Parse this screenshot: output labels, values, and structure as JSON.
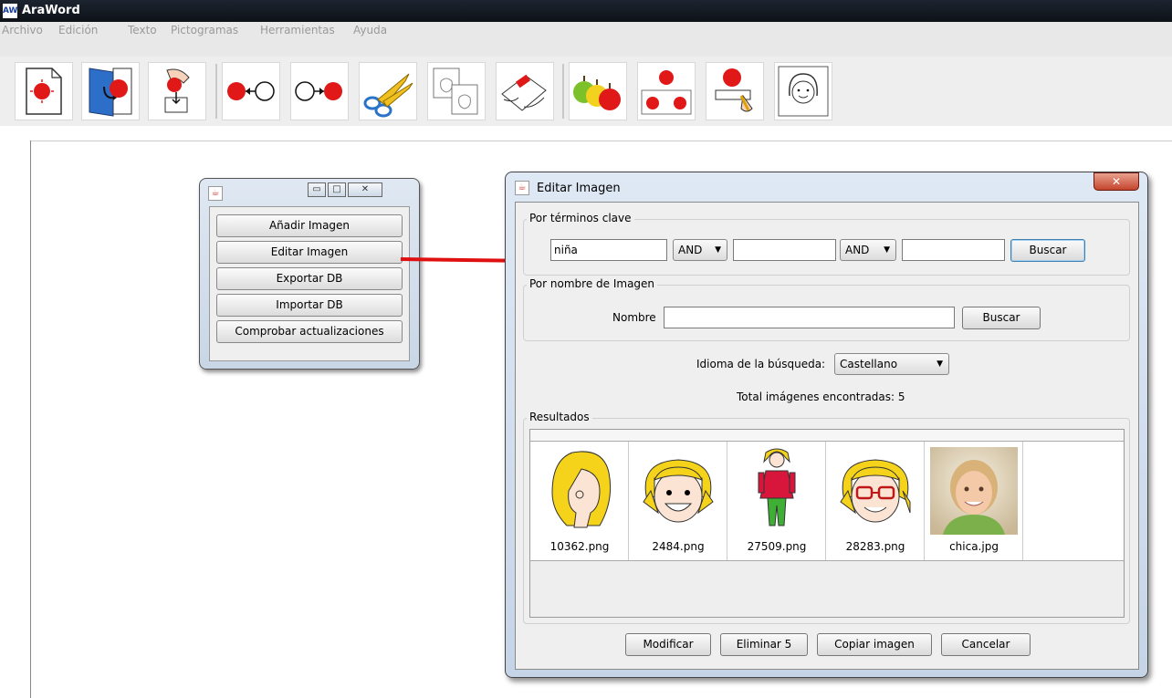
{
  "window": {
    "logo": "AW",
    "title": "AraWord"
  },
  "menu": [
    "Archivo",
    "Edición",
    "Texto",
    "Pictogramas",
    "Herramientas",
    "Ayuda"
  ],
  "toolbar_icons": [
    "new-document-icon",
    "open-door-icon",
    "hand-dropping-icon",
    "arrow-left-icon",
    "arrow-right-icon",
    "scissors-icon",
    "copy-icon",
    "paste-icon",
    "apples-icon",
    "apples-split-icon",
    "apple-writing-icon",
    "girl-face-icon"
  ],
  "small_dialog": {
    "buttons": [
      "Añadir Imagen",
      "Editar Imagen",
      "Exportar DB",
      "Importar DB",
      "Comprobar actualizaciones"
    ]
  },
  "edit_dialog": {
    "title": "Editar Imagen",
    "keywords": {
      "legend": "Por términos clave",
      "term1": "niña",
      "op1": "AND",
      "term2": "",
      "op2": "AND",
      "term3": "",
      "search": "Buscar"
    },
    "by_name": {
      "legend": "Por nombre de Imagen",
      "label": "Nombre",
      "value": "",
      "search": "Buscar"
    },
    "language": {
      "label": "Idioma de la búsqueda:",
      "value": "Castellano"
    },
    "total": {
      "label": "Total imágenes encontradas:",
      "count": "5"
    },
    "results": {
      "legend": "Resultados",
      "items": [
        {
          "file": "10362.png",
          "icon": "girl-profile-icon"
        },
        {
          "file": "2484.png",
          "icon": "girl-smiling-face-icon"
        },
        {
          "file": "27509.png",
          "icon": "girl-standing-icon"
        },
        {
          "file": "28283.png",
          "icon": "girl-glasses-face-icon"
        },
        {
          "file": "chica.jpg",
          "icon": "girl-photo"
        }
      ]
    },
    "buttons": {
      "modify": "Modificar",
      "delete": "Eliminar 5",
      "copy": "Copiar imagen",
      "cancel": "Cancelar"
    }
  },
  "colors": {
    "arrow": "#e01010",
    "titlebar": "#111822",
    "dialog_frame": "#c8d8ea"
  }
}
